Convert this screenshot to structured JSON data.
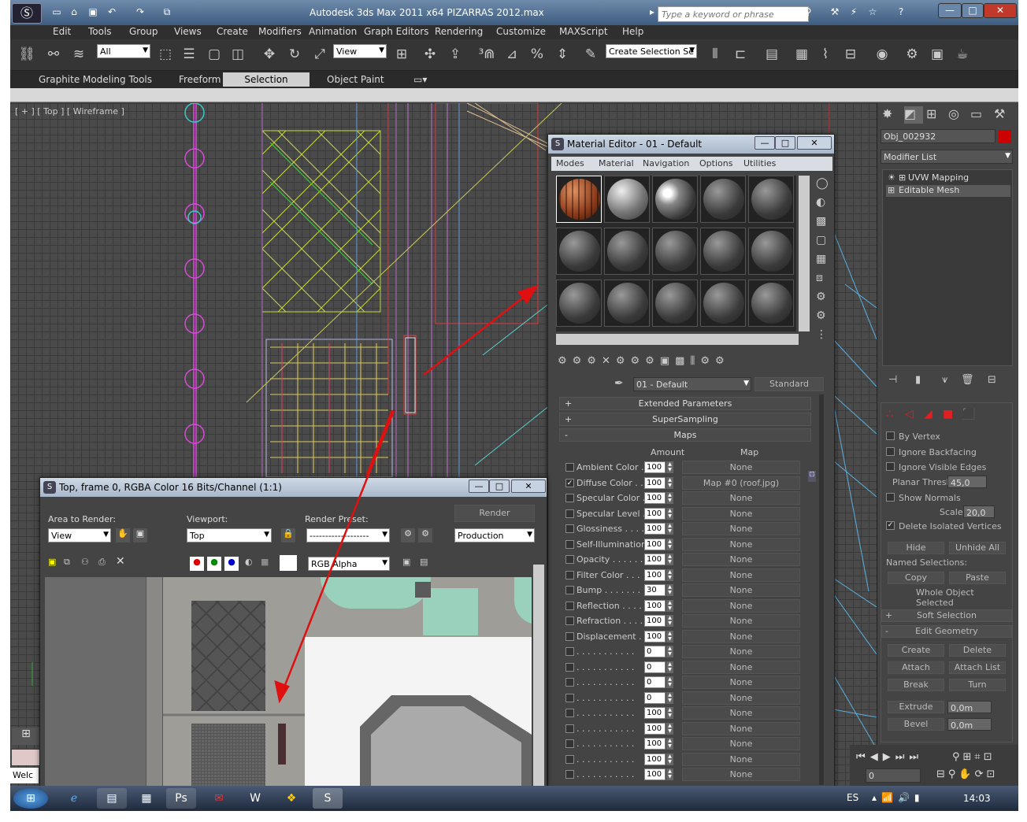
{
  "title_bar": {
    "title": "Autodesk 3ds Max  2011 x64      PIZARRAS 2012.max",
    "search_placeholder": "Type a keyword or phrase"
  },
  "menu": {
    "items": [
      "Edit",
      "Tools",
      "Group",
      "Views",
      "Create",
      "Modifiers",
      "Animation",
      "Graph Editors",
      "Rendering",
      "Customize",
      "MAXScript",
      "Help"
    ]
  },
  "main_toolbar": {
    "filter_value": "All",
    "reference_coord": "View",
    "named_selection": "Create Selection Se"
  },
  "ribbon": {
    "tabs": [
      "Graphite Modeling Tools",
      "Freeform",
      "Selection",
      "Object Paint"
    ],
    "active_tab": "Selection"
  },
  "viewport": {
    "label": "[ + ] [ Top ] [ Wireframe ]"
  },
  "command_panel": {
    "object_name": "Obj_002932",
    "object_color": "#cc0000",
    "modifier_list": "Modifier List",
    "stack": [
      "UVW Mapping",
      "Editable Mesh"
    ],
    "options": [
      {
        "label": "By Vertex",
        "checked": false
      },
      {
        "label": "Ignore Backfacing",
        "checked": false
      },
      {
        "label": "Ignore Visible Edges",
        "checked": false
      }
    ],
    "planar_thresh_label": "Planar Thresh:",
    "planar_thresh_value": "45,0",
    "show_normals": "Show Normals",
    "scale_label": "Scale:",
    "scale_value": "20,0",
    "delete_isolated": "Delete Isolated Vertices",
    "hide": "Hide",
    "unhide_all": "Unhide All",
    "named_selections": "Named Selections:",
    "copy": "Copy",
    "paste": "Paste",
    "whole_object": "Whole Object Selected",
    "soft_selection": "Soft Selection",
    "edit_geometry": "Edit Geometry",
    "create": "Create",
    "delete": "Delete",
    "attach": "Attach",
    "attach_list": "Attach List",
    "break": "Break",
    "turn": "Turn",
    "extrude": "Extrude",
    "extrude_value": "0,0m",
    "bevel": "Bevel",
    "bevel_value": "0,0m"
  },
  "material_editor": {
    "title": "Material Editor - 01 - Default",
    "menu": [
      "Modes",
      "Material",
      "Navigation",
      "Options",
      "Utilities"
    ],
    "material_name": "01 - Default",
    "material_type": "Standard",
    "rollouts": [
      "Extended Parameters",
      "SuperSampling",
      "Maps"
    ],
    "maps_header": {
      "amount": "Amount",
      "map": "Map"
    },
    "maps": [
      {
        "label": "Ambient Color . .",
        "amount": "100",
        "map": "None",
        "checked": false
      },
      {
        "label": "Diffuse Color . .",
        "amount": "100",
        "map": "Map #0 (roof.jpg)",
        "checked": true
      },
      {
        "label": "Specular Color . .",
        "amount": "100",
        "map": "None",
        "checked": false
      },
      {
        "label": "Specular Level  .",
        "amount": "100",
        "map": "None",
        "checked": false
      },
      {
        "label": "Glossiness  . . . .",
        "amount": "100",
        "map": "None",
        "checked": false
      },
      {
        "label": "Self-Illumination .",
        "amount": "100",
        "map": "None",
        "checked": false
      },
      {
        "label": "Opacity . . . . . .",
        "amount": "100",
        "map": "None",
        "checked": false
      },
      {
        "label": "Filter Color  . . .",
        "amount": "100",
        "map": "None",
        "checked": false
      },
      {
        "label": "Bump  . . . . . . .",
        "amount": "30",
        "map": "None",
        "checked": false
      },
      {
        "label": "Reflection  . . . .",
        "amount": "100",
        "map": "None",
        "checked": false
      },
      {
        "label": "Refraction  . . . .",
        "amount": "100",
        "map": "None",
        "checked": false
      },
      {
        "label": "Displacement  . .",
        "amount": "100",
        "map": "None",
        "checked": false
      },
      {
        "label": ". . . . . . . . . . .",
        "amount": "0",
        "map": "None",
        "checked": false
      },
      {
        "label": ". . . . . . . . . . .",
        "amount": "0",
        "map": "None",
        "checked": false
      },
      {
        "label": ". . . . . . . . . . .",
        "amount": "0",
        "map": "None",
        "checked": false
      },
      {
        "label": ". . . . . . . . . . .",
        "amount": "0",
        "map": "None",
        "checked": false
      },
      {
        "label": ". . . . . . . . . . .",
        "amount": "100",
        "map": "None",
        "checked": false
      },
      {
        "label": ". . . . . . . . . . .",
        "amount": "100",
        "map": "None",
        "checked": false
      },
      {
        "label": ". . . . . . . . . . .",
        "amount": "100",
        "map": "None",
        "checked": false
      },
      {
        "label": ". . . . . . . . . . .",
        "amount": "100",
        "map": "None",
        "checked": false
      },
      {
        "label": ". . . . . . . . . . .",
        "amount": "100",
        "map": "None",
        "checked": false
      }
    ]
  },
  "render_window": {
    "title": "Top, frame 0, RGBA Color 16 Bits/Channel (1:1)",
    "area_label": "Area to Render:",
    "area_value": "View",
    "viewport_label": "Viewport:",
    "viewport_value": "Top",
    "preset_label": "Render Preset:",
    "preset_value": "-------------------",
    "render_button": "Render",
    "production_value": "Production",
    "channel_value": "RGB Alpha"
  },
  "status": {
    "welcome": "Welc",
    "frame": "0"
  },
  "taskbar": {
    "language": "ES",
    "time": "14:03"
  }
}
